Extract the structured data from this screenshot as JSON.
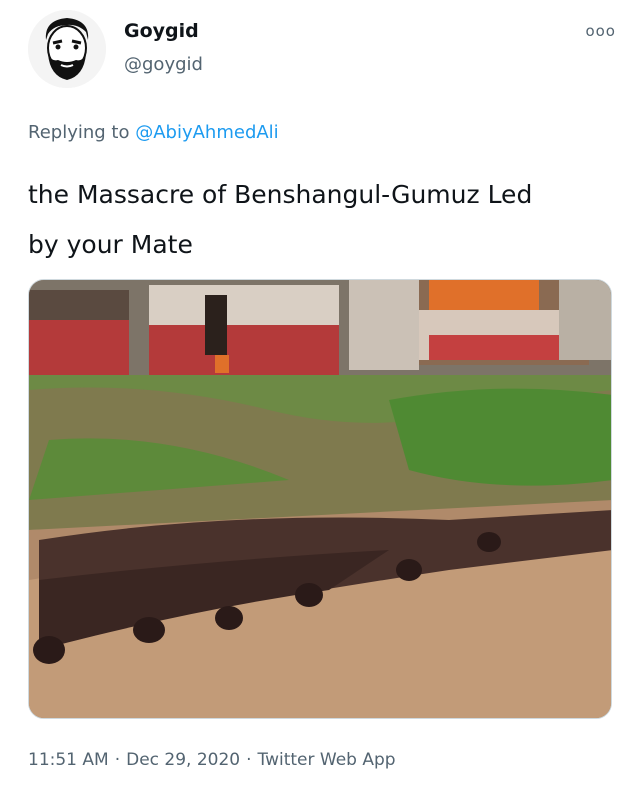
{
  "user": {
    "display_name": "Goygid",
    "handle": "@goygid",
    "avatar_icon": "bearded-man-avatar-icon"
  },
  "menu": {
    "more_label": "ooo"
  },
  "reply": {
    "prefix": "Replying to",
    "mention": "@AbiyAhmedAli"
  },
  "tweet": {
    "text_line1": "the Massacre of Benshangul-Gumuz Led",
    "text_line2": "by your Mate"
  },
  "media": {
    "icon": "photo-icon",
    "colors": {
      "wall": "#b43a3a",
      "grass": "#5d8a3a",
      "ground": "#b08a6a",
      "fire": "#e0702a"
    }
  },
  "meta": {
    "time": "11:51 AM",
    "separator": "·",
    "date": "Dec 29, 2020",
    "source": "Twitter Web App"
  },
  "colors": {
    "accent": "#1d9bf0",
    "secondary_text": "#536471"
  }
}
